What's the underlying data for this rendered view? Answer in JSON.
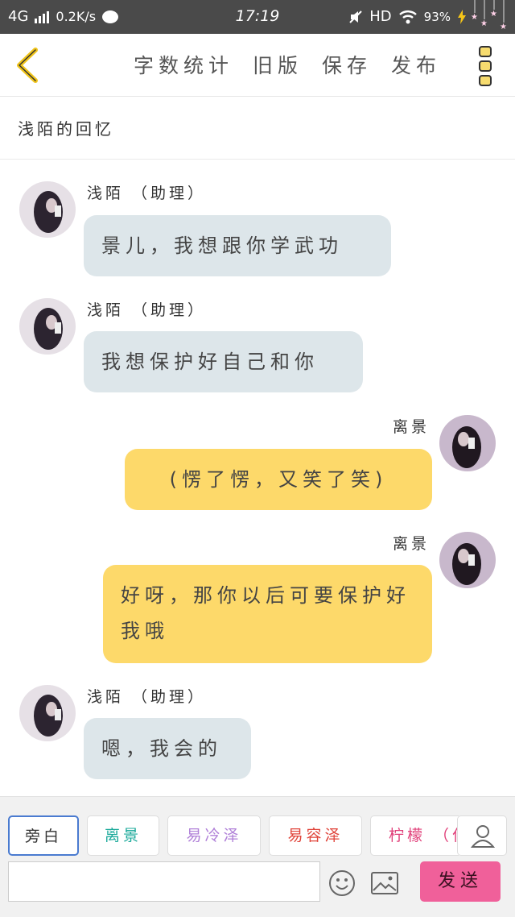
{
  "status_bar": {
    "network": "4G",
    "speed": "0.2K/s",
    "time": "17:19",
    "hd": "HD",
    "battery": "93%"
  },
  "toolbar": {
    "actions": [
      "字数统计",
      "旧版",
      "保存",
      "发布"
    ]
  },
  "story_title": "浅陌的回忆",
  "messages": [
    {
      "side": "left",
      "name": "浅陌 （助理）",
      "text": "景儿，我想跟你学武功"
    },
    {
      "side": "left",
      "name": "浅陌 （助理）",
      "text": "我想保护好自己和你"
    },
    {
      "side": "right",
      "name": "离景",
      "text": "(愣了愣，又笑了笑)"
    },
    {
      "side": "right",
      "name": "离景",
      "text": "好呀，那你以后可要保护好我哦"
    },
    {
      "side": "left",
      "name": "浅陌 （助理）",
      "text": "嗯，我会的"
    }
  ],
  "roles": [
    {
      "label": "旁白",
      "color": "#333333",
      "active": true
    },
    {
      "label": "离景",
      "color": "#1aa99a",
      "active": false
    },
    {
      "label": "易冷泽",
      "color": "#b080d8",
      "active": false
    },
    {
      "label": "易容泽",
      "color": "#e0443a",
      "active": false
    },
    {
      "label": "柠檬 （作",
      "color": "#e0407a",
      "active": false
    }
  ],
  "input": {
    "value": "",
    "placeholder": ""
  },
  "send_label": "发送",
  "colors": {
    "status_bar": "#4a4a4a",
    "left_bubble": "#dde6ea",
    "right_bubble": "#fdd96a",
    "send_button": "#f0609a",
    "back_icon": "#f0c419"
  }
}
